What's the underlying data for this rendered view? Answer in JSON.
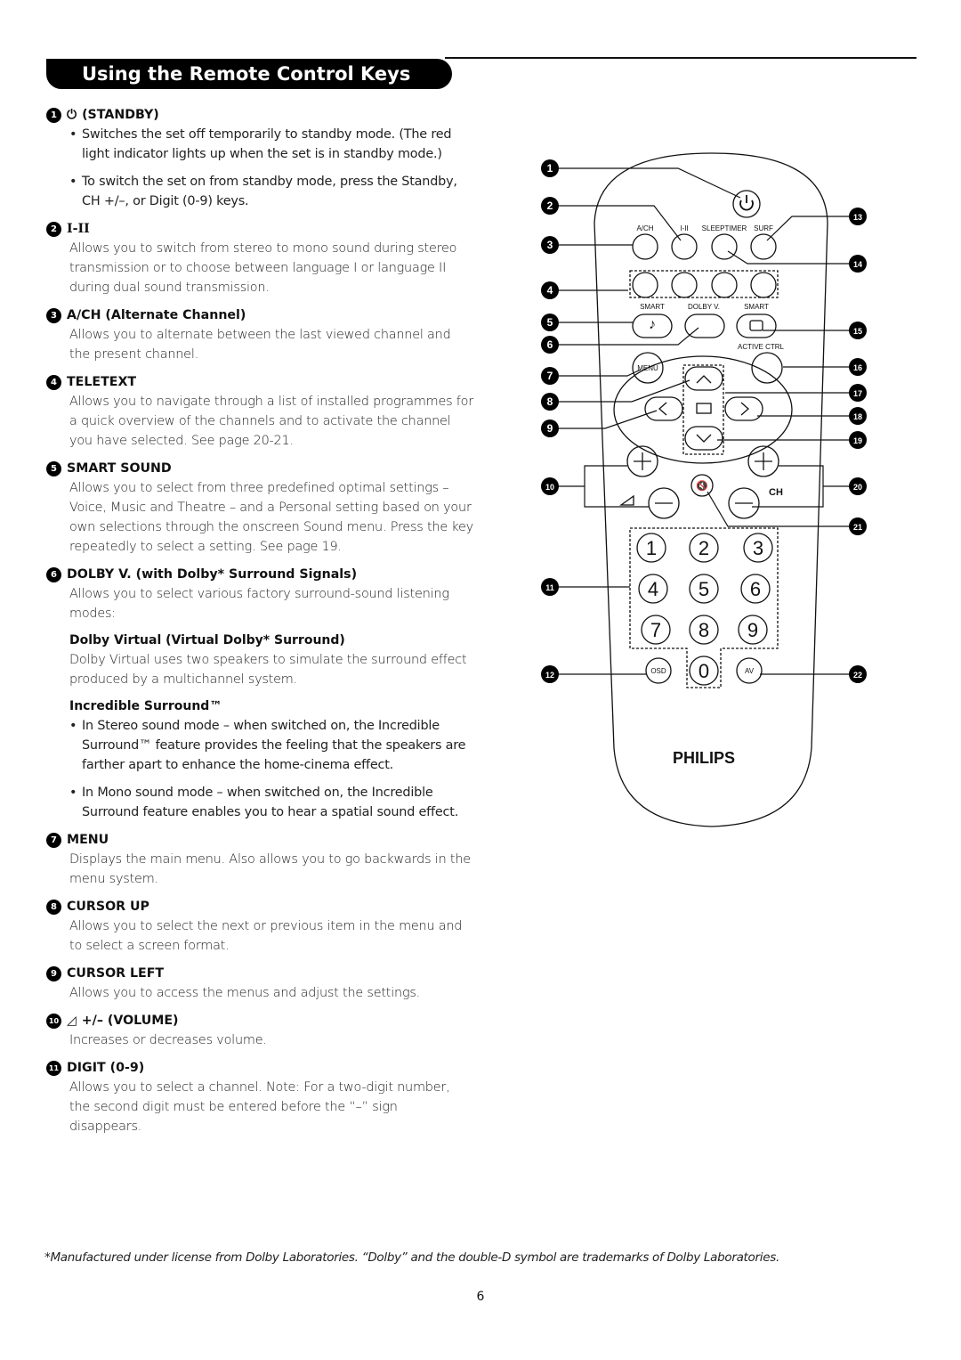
{
  "page": {
    "title": "Using the Remote Control Keys",
    "page_number": "6",
    "footnote": "*Manufactured under license from Dolby Laboratories. “Dolby” and the double-D symbol are trademarks of Dolby Laboratories."
  },
  "sections": [
    {
      "num": "1",
      "icon": "⏻",
      "title": "(STANDBY)",
      "bullets": [
        "Switches the set off temporarily to standby mode. (The red light indicator lights up when the set is in standby mode.)",
        "To switch the set on from standby mode, press the Standby, CH +/–, or Digit (0-9) keys."
      ]
    },
    {
      "num": "2",
      "title": "I-II",
      "text": "Allows you to switch from stereo to mono sound during stereo transmission or to choose between language I or language II during dual sound transmission."
    },
    {
      "num": "3",
      "title": "A/CH (Alternate Channel)",
      "text": "Allows you to alternate between the last viewed channel and the present channel."
    },
    {
      "num": "4",
      "title": "TELETEXT",
      "text": "Allows you to navigate through a list of installed programmes for a quick overview of the channels and to activate the channel you have selected. See page 20-21."
    },
    {
      "num": "5",
      "title": "SMART SOUND",
      "text": "Allows you to select from three predefined optimal settings – Voice, Music and Theatre – and a Personal setting based on your own selections through the onscreen Sound menu. Press the key repeatedly to select a setting. See page 19."
    },
    {
      "num": "6",
      "title": "DOLBY V. (with Dolby* Surround Signals)",
      "text": "Allows you to select various factory surround-sound listening modes:",
      "sub1_title": "Dolby Virtual (Virtual Dolby* Surround)",
      "sub1_text": "Dolby Virtual uses two speakers to simulate the surround effect produced by a multichannel system.",
      "sub2_title": "Incredible Surround™",
      "sub2_bullets": [
        "In Stereo sound mode – when switched on, the Incredible Surround™ feature provides the feeling that the speakers are farther apart to enhance the home-cinema effect.",
        "In Mono sound mode – when switched on, the Incredible Surround feature enables you to hear a spatial sound effect."
      ]
    },
    {
      "num": "7",
      "title": "MENU",
      "text": "Displays the main menu. Also allows you to go backwards in the menu system."
    },
    {
      "num": "8",
      "title": "CURSOR UP",
      "text": "Allows you to select the next or previous item in the menu and to select a screen format."
    },
    {
      "num": "9",
      "title": "CURSOR LEFT",
      "text": "Allows you to access the menus and adjust the settings."
    },
    {
      "num": "10",
      "icon": "◿",
      "title": "+/– (VOLUME)",
      "text": "Increases or decreases volume."
    },
    {
      "num": "11",
      "title": "DIGIT (0-9)",
      "text": "Allows you to select a channel. Note: For a two-digit number, the second digit must be entered before the “–” sign disappears."
    }
  ],
  "remote": {
    "labels": {
      "ach": "A/CH",
      "i_ii": "I-II",
      "sleeptimer": "SLEEPTIMER",
      "surf": "SURF",
      "smart_sound": "SMART",
      "dolby": "DOLBY V.",
      "smart_picture": "SMART",
      "active_ctrl": "ACTIVE CTRL",
      "menu": "MENU",
      "ch": "CH",
      "osd": "OSD",
      "av": "AV",
      "brand": "PHILIPS"
    },
    "digits": [
      "1",
      "2",
      "3",
      "4",
      "5",
      "6",
      "7",
      "8",
      "9",
      "0"
    ],
    "callouts": [
      "1",
      "2",
      "3",
      "4",
      "5",
      "6",
      "7",
      "8",
      "9",
      "10",
      "11",
      "12",
      "13",
      "14",
      "15",
      "16",
      "17",
      "18",
      "19",
      "20",
      "21",
      "22"
    ]
  }
}
